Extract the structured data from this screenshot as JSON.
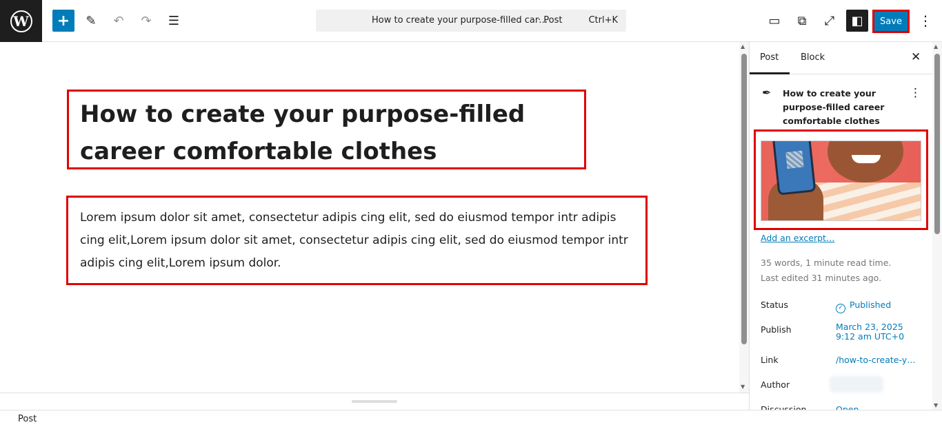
{
  "toolbar": {
    "add_icon": "plus-icon",
    "command_title": "How to create your purpose-filled car…",
    "command_kind": "· Post",
    "command_shortcut": "Ctrl+K",
    "save_label": "Save"
  },
  "post": {
    "title": "How to create your purpose-filled career comfortable clothes",
    "paragraph": "Lorem ipsum dolor sit amet, consectetur adipis cing elit, sed do eiusmod tempor intr adipis cing elit,Lorem ipsum dolor sit amet, consectetur adipis cing elit, sed do eiusmod tempor intr adipis cing elit,Lorem ipsum dolor."
  },
  "sidebar": {
    "tab_post": "Post",
    "tab_block": "Block",
    "summary_title": "How to create your purpose-filled career comfortable clothes",
    "add_excerpt": "Add an excerpt…",
    "word_count": "35 words, 1 minute read time.",
    "last_edited": "Last edited 31 minutes ago.",
    "rows": {
      "status_label": "Status",
      "status_value": "Published",
      "publish_label": "Publish",
      "publish_date": "March 23, 2025",
      "publish_time": "9:12 am UTC+0",
      "link_label": "Link",
      "link_value": "/how-to-create-y…",
      "author_label": "Author",
      "discussion_label": "Discussion",
      "discussion_value": "Open"
    }
  },
  "footer": {
    "breadcrumb": "Post"
  },
  "colors": {
    "accent": "#007cba",
    "highlight": "#e00000",
    "dark": "#1e1e1e"
  }
}
